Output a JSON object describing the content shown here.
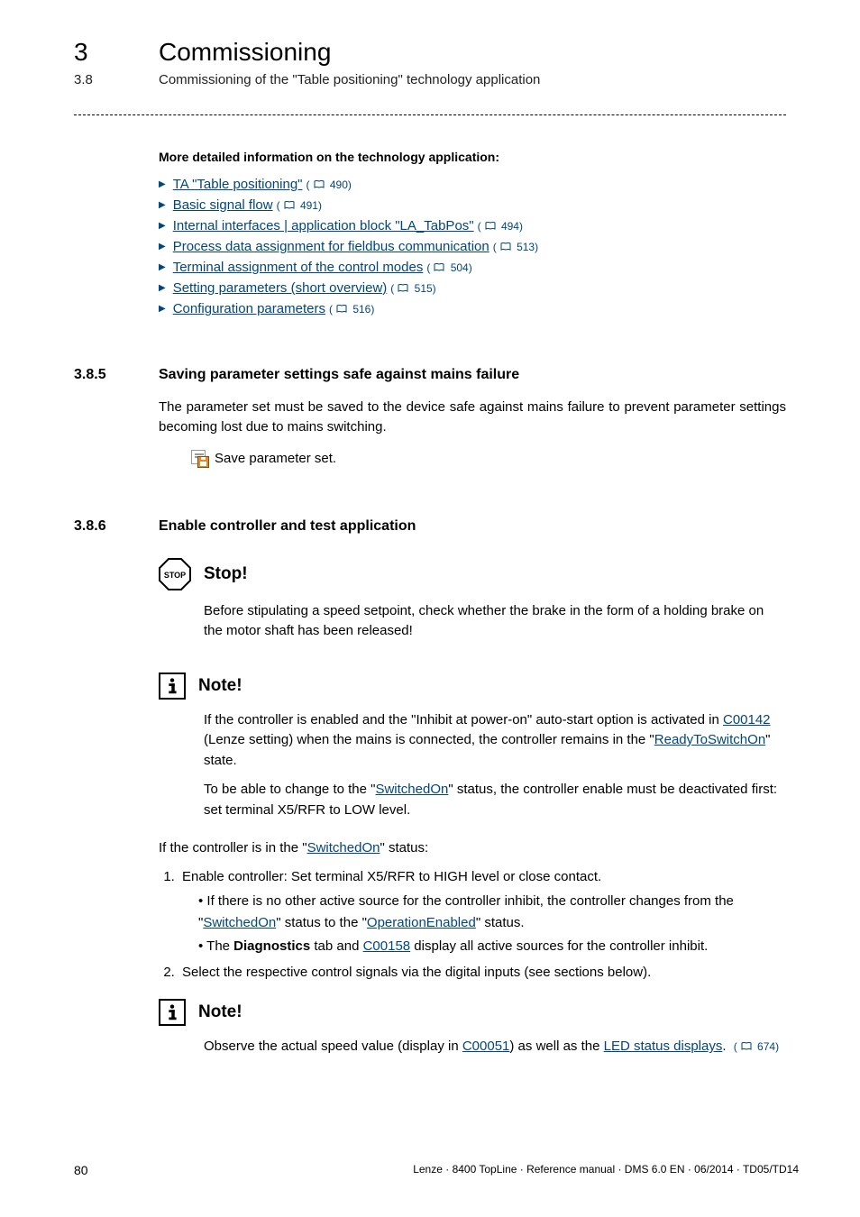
{
  "header": {
    "chapter_number": "3",
    "chapter_title": "Commissioning",
    "section_number": "3.8",
    "section_title": "Commissioning of the \"Table positioning\" technology application"
  },
  "intro_heading": "More detailed information on the technology application:",
  "links": [
    {
      "text": "TA \"Table positioning\"",
      "page": "490"
    },
    {
      "text": "Basic signal flow",
      "page": "491"
    },
    {
      "text": "Internal interfaces | application block \"LA_TabPos\"",
      "page": "494"
    },
    {
      "text": "Process data assignment for fieldbus communication",
      "page": "513"
    },
    {
      "text": "Terminal assignment of the control modes",
      "page": "504"
    },
    {
      "text": "Setting parameters (short overview)",
      "page": "515"
    },
    {
      "text": "Configuration parameters",
      "page": "516"
    }
  ],
  "sec385": {
    "num": "3.8.5",
    "title": "Saving parameter settings safe against mains failure",
    "body": "The parameter set must be saved to the device safe against mains failure to prevent parameter settings becoming lost due to mains switching.",
    "save_label": "Save parameter set."
  },
  "sec386": {
    "num": "3.8.6",
    "title": "Enable controller and test application"
  },
  "stop": {
    "title": "Stop!",
    "body": "Before stipulating a speed setpoint, check whether the brake in the form of a holding brake on the motor shaft has been released!"
  },
  "note1": {
    "title": "Note!",
    "p1_a": "If the controller is enabled and the \"Inhibit at power-on\" auto-start option is activated in ",
    "p1_link": "C00142",
    "p1_b": " (Lenze setting) when the mains is connected, the controller remains in the \"",
    "p1_link2": "ReadyToSwitchOn",
    "p1_c": "\" state.",
    "p2_a": "To be able to change to the \"",
    "p2_link": "SwitchedOn",
    "p2_b": "\" status, the controller enable must be deactivated first: set terminal X5/RFR to LOW level."
  },
  "status_line_a": "If the controller is in the \"",
  "status_link": "SwitchedOn",
  "status_line_b": "\" status:",
  "steps": {
    "s1": "Enable controller: Set terminal X5/RFR to HIGH level or close contact.",
    "s1a_a": "If there is no other active source for the controller inhibit, the controller changes from the \"",
    "s1a_link1": "SwitchedOn",
    "s1a_b": "\" status to the \"",
    "s1a_link2": "OperationEnabled",
    "s1a_c": "\" status.",
    "s1b_a": "The ",
    "s1b_bold": "Diagnostics",
    "s1b_b": " tab and ",
    "s1b_link": "C00158",
    "s1b_c": " display all active sources for the controller inhibit.",
    "s2": "Select the respective control signals via the digital inputs (see sections below)."
  },
  "note2": {
    "title": "Note!",
    "a": "Observe the actual speed value (display in ",
    "link1": "C00051",
    "b": ") as well as the ",
    "link2": "LED status displays",
    "c": ". ",
    "page": "674"
  },
  "footer": {
    "page": "80",
    "info": "Lenze · 8400 TopLine · Reference manual · DMS 6.0 EN · 06/2014 · TD05/TD14"
  }
}
